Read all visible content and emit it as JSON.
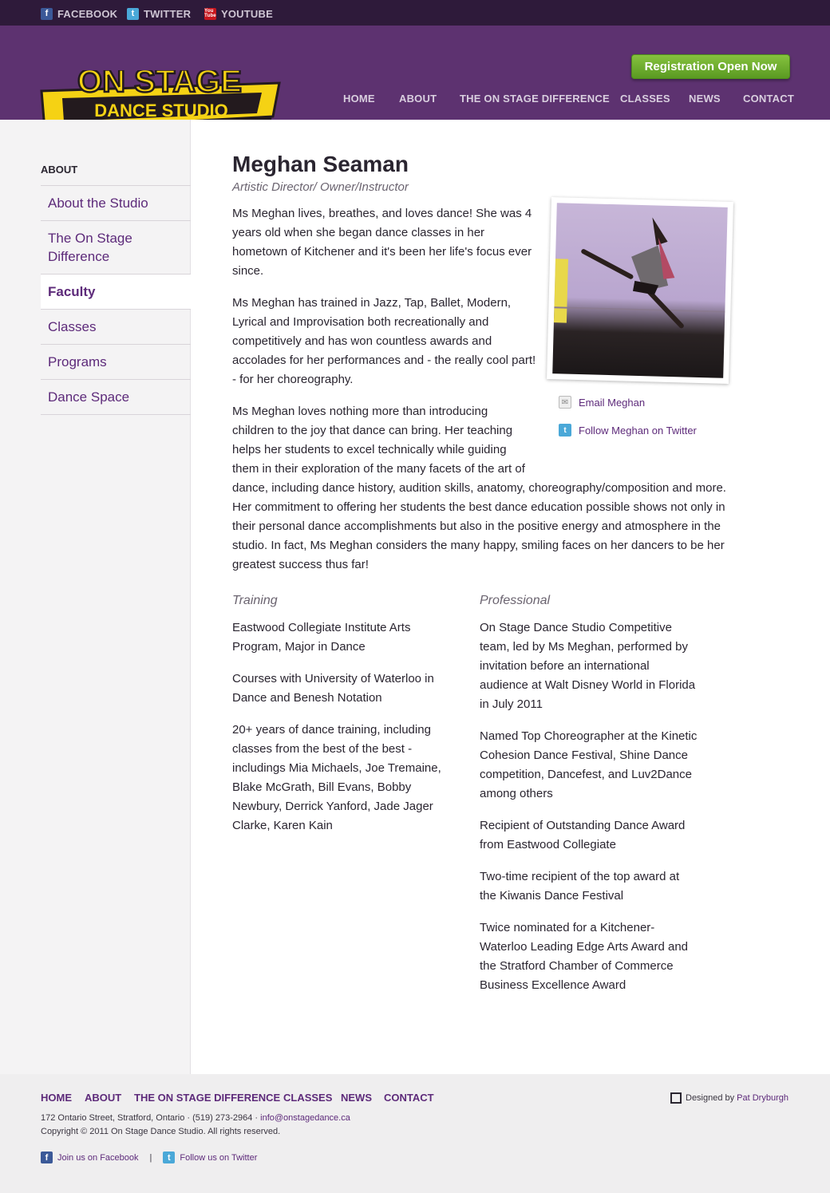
{
  "social": {
    "facebook": "FACEBOOK",
    "twitter": "TWITTER",
    "youtube": "YOUTUBE"
  },
  "header": {
    "logo_line1": "ON STAGE",
    "logo_line2": "DANCE STUDIO",
    "registration_button": "Registration Open Now",
    "nav": [
      "HOME",
      "ABOUT",
      "THE ON STAGE DIFFERENCE",
      "CLASSES",
      "NEWS",
      "CONTACT"
    ]
  },
  "sidebar": {
    "heading": "ABOUT",
    "items": [
      {
        "label": "About the Studio"
      },
      {
        "label": "The On Stage Difference"
      },
      {
        "label": "Faculty"
      },
      {
        "label": "Classes"
      },
      {
        "label": "Programs"
      },
      {
        "label": "Dance Space"
      }
    ],
    "active_item": "Faculty"
  },
  "profile": {
    "name": "Meghan Seaman",
    "role": "Artistic Director/ Owner/Instructor",
    "paragraphs": [
      "Ms Meghan lives, breathes, and loves dance! She was 4 years old when she began dance classes in her hometown of Kitchener and it's been her life's focus ever since.",
      "Ms Meghan has trained in Jazz, Tap, Ballet, Modern, Lyrical and Improvisation both recreationally and competitively and has won countless awards and accolades for her performances and - the really cool part! - for her choreography.",
      "Ms Meghan loves nothing more than introducing children to the joy that dance can bring. Her teaching helps her students to excel technically while guiding them in their exploration of the many facets of the art of dance, including dance history, audition skills, anatomy, choreography/composition and more. Her commitment to offering her students the best dance education possible shows not only in their personal dance accomplishments but also in the positive energy and atmosphere in the studio. In fact, Ms Meghan considers the many happy, smiling faces on her dancers to be her greatest success thus far!"
    ],
    "email_link": "Email Meghan",
    "twitter_link": "Follow Meghan on Twitter"
  },
  "training": {
    "title": "Training",
    "items": [
      "Eastwood Collegiate Institute Arts Program, Major in Dance",
      "Courses with University of Waterloo in Dance and Benesh Notation",
      "20+ years of dance training, including classes from the best of the best - includings Mia Michaels, Joe Tremaine, Blake McGrath, Bill Evans, Bobby Newbury, Derrick Yanford, Jade Jager Clarke, Karen Kain"
    ]
  },
  "professional": {
    "title": "Professional",
    "items": [
      "On Stage Dance Studio Competitive team, led by Ms Meghan, performed by invitation before an international audience at Walt Disney World in Florida in July 2011",
      "Named Top Choreographer at the Kinetic Cohesion Dance Festival, Shine Dance competition, Dancefest, and Luv2Dance among others",
      "Recipient of Outstanding Dance Award from Eastwood Collegiate",
      "Two-time recipient of the top award at the Kiwanis Dance Festival",
      "Twice nominated for a Kitchener-Waterloo Leading Edge Arts Award and the Stratford Chamber of Commerce Business Excellence Award"
    ]
  },
  "footer": {
    "nav": [
      "HOME",
      "ABOUT",
      "THE ON STAGE DIFFERENCE",
      "CLASSES",
      "NEWS",
      "CONTACT"
    ],
    "address": "172 Ontario Street, Stratford, Ontario · (519) 273-2964 ·",
    "email": "info@onstagedance.ca",
    "copyright": "Copyright © 2011 On Stage Dance Studio. All rights reserved.",
    "facebook": "Join us on Facebook",
    "separator": "|",
    "twitter": "Follow us on Twitter",
    "designed_by": "Designed by",
    "designer": "Pat Dryburgh"
  },
  "colors": {
    "header": "#5d3270",
    "topbar": "#2e1a3a",
    "link": "#5d2a7a",
    "button": "#6fad2e",
    "logo_yellow": "#f5d214"
  }
}
